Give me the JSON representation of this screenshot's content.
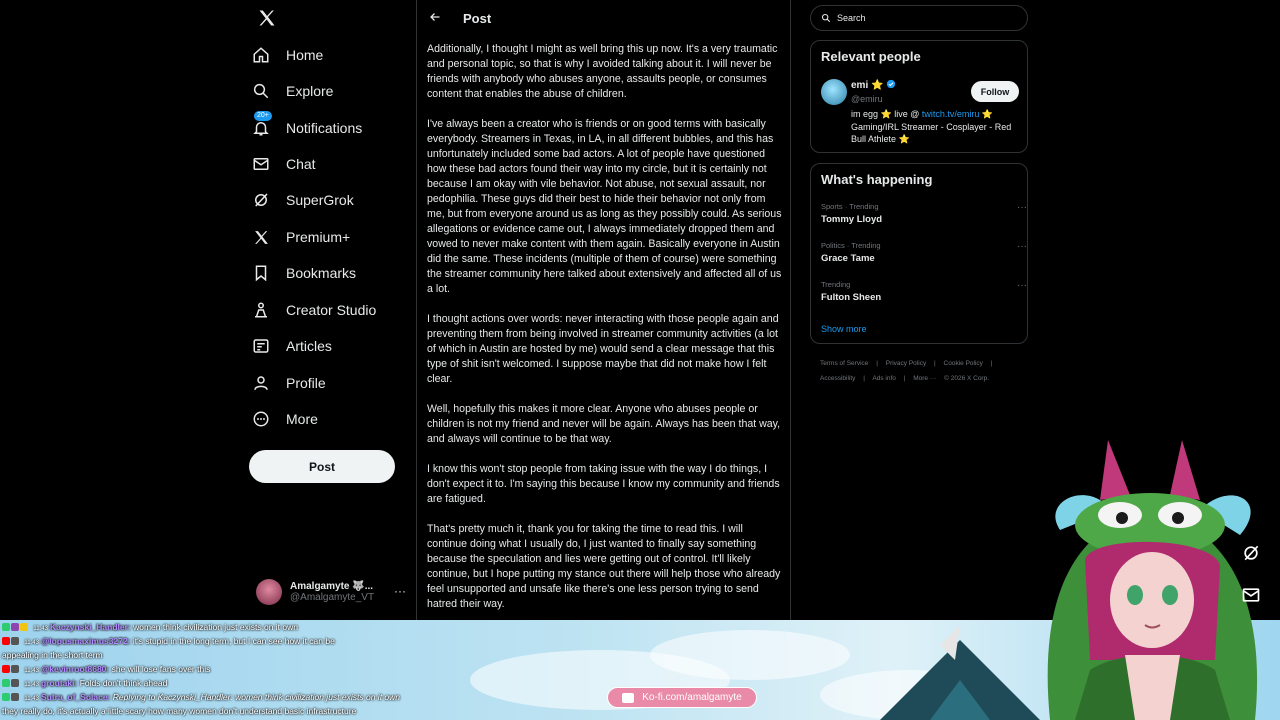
{
  "nav": {
    "items": [
      {
        "label": "Home",
        "icon": "home-icon"
      },
      {
        "label": "Explore",
        "icon": "search-icon"
      },
      {
        "label": "Notifications",
        "icon": "bell-icon",
        "badge": "20+"
      },
      {
        "label": "Chat",
        "icon": "mail-icon"
      },
      {
        "label": "SuperGrok",
        "icon": "grok-icon"
      },
      {
        "label": "Premium+",
        "icon": "x-logo-icon"
      },
      {
        "label": "Bookmarks",
        "icon": "bookmark-icon"
      },
      {
        "label": "Creator Studio",
        "icon": "creator-icon"
      },
      {
        "label": "Articles",
        "icon": "articles-icon"
      },
      {
        "label": "Profile",
        "icon": "person-icon"
      },
      {
        "label": "More",
        "icon": "more-circle-icon"
      }
    ],
    "post_label": "Post",
    "account": {
      "name": "Amalgamyte 🐺...",
      "handle": "@Amalgamyte_VT"
    }
  },
  "main": {
    "title": "Post",
    "paragraphs": [
      "Additionally, I thought I might as well bring this up now. It's a very traumatic and personal topic, so that is why I avoided talking about it. I will never be friends with anybody who abuses anyone, assaults people, or consumes content that enables the abuse of children.",
      "I've always been a creator who is friends or on good terms with basically everybody. Streamers in Texas, in LA, in all different bubbles, and this has unfortunately included some bad actors. A lot of people have questioned how these bad actors found their way into my circle, but it is certainly not because I am okay with vile behavior. Not abuse, not sexual assault, nor pedophilia. These guys did their best to hide their behavior not only from me, but from everyone around us as long as they possibly could. As serious allegations or evidence came out, I always immediately dropped them and vowed to never make content with them again. Basically everyone in Austin did the same. These incidents (multiple of them of course) were something the streamer community here talked about extensively and affected all of us a lot.",
      "I thought actions over words: never interacting with those people again and preventing them from being involved in streamer community activities (a lot of which in Austin are hosted by me) would send a clear message that this type of shit isn't welcomed. I suppose maybe that did not make how I felt clear.",
      "Well, hopefully this makes it more clear. Anyone who abuses people or children is not my friend and never will be again. Always has been that way, and always will continue to be that way.",
      "I know this won't stop people from taking issue with the way I do things, I don't expect it to. I'm saying this because I know my community and friends are fatigued.",
      "That's pretty much it, thank you for taking the time to read this. I will continue doing what I usually do, I just wanted to finally say something because the speculation and lies were getting out of control. It'll likely continue, but I hope putting my stance out there will help those who already feel unsupported and unsafe like there's one less person trying to send hatred their way."
    ]
  },
  "right": {
    "search_placeholder": "Search",
    "relevant": {
      "title": "Relevant people",
      "name": "emi ⭐",
      "handle": "@emiru",
      "follow_label": "Follow",
      "bio_pre": "im egg ⭐ live @ ",
      "bio_link": "twitch.tv/emiru",
      "bio_post": " ⭐ Gaming/IRL Streamer - Cosplayer - Red Bull Athlete ⭐"
    },
    "happening": {
      "title": "What's happening",
      "trends": [
        {
          "meta": "Sports · Trending",
          "name": "Tommy Lloyd"
        },
        {
          "meta": "Politics · Trending",
          "name": "Grace Tame"
        },
        {
          "meta": "Trending",
          "name": "Fulton Sheen"
        }
      ],
      "show_more": "Show more"
    },
    "footer": {
      "line1": [
        "Terms of Service",
        "|",
        "Privacy Policy",
        "|",
        "Cookie Policy",
        "|"
      ],
      "line2": [
        "Accessibility",
        "|",
        "Ads info",
        "|",
        "More ···",
        "© 2026 X Corp."
      ]
    }
  },
  "chat": {
    "lines": [
      {
        "time": "11:43",
        "user": "Kaczynski_Handler:",
        "msg": " women think civilization just exists on it own",
        "icons": [
          "#2ecc71",
          "#8e44ad",
          "#f1c40f"
        ]
      },
      {
        "time": "11:43",
        "user": "@lopusmaximus3272:",
        "msg": " it's stupid in the long term, but I can see how it can be",
        "icons": [
          "#ff0000",
          "#555555"
        ]
      },
      {
        "time": "",
        "user": "",
        "msg": "appealing in the short term",
        "icons": []
      },
      {
        "time": "11:43",
        "user": "@kevinroot8680:",
        "msg": " she will lose fans over this",
        "icons": [
          "#ff0000",
          "#555555"
        ]
      },
      {
        "time": "11:43",
        "user": "groutaki:",
        "msg": " Folds don't think ahead",
        "icons": [
          "#2ecc71",
          "#555555"
        ]
      },
      {
        "time": "11:43",
        "user": "Sutra_of_Solace:",
        "msg": " Replying to Kaczynski_Handler: women think civilization just exists on it own",
        "icons": [
          "#2ecc71",
          "#555555"
        ]
      },
      {
        "time": "",
        "user": "",
        "msg": "they really do, it's actually a little scary how many women don't understand basic infrastructure",
        "icons": []
      }
    ],
    "kofi": "Ko-fi.com/amalgamyte"
  },
  "colors": {
    "accent": "#1d9bf0",
    "text": "#e7e9ea",
    "muted": "#71767b",
    "border": "#2f3336",
    "chat_user": "#b48cff"
  }
}
